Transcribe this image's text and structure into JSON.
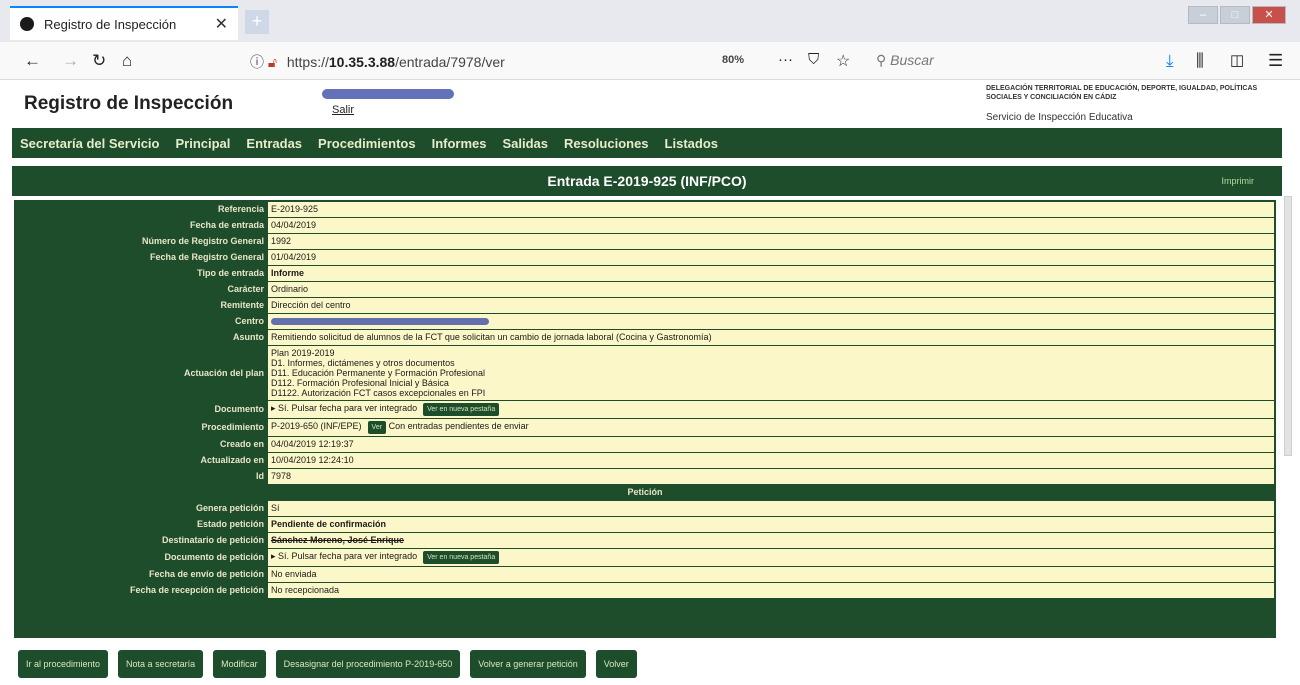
{
  "browser": {
    "tab_title": "Registro de Inspección",
    "url_prefix": "https://",
    "url_host": "10.35.3.88",
    "url_path": "/entrada/7978/ver",
    "zoom": "80%",
    "search_placeholder": "Buscar"
  },
  "site": {
    "title": "Registro de Inspección",
    "salir": "Salir",
    "delegacion": "DELEGACIÓN TERRITORIAL DE EDUCACIÓN, DEPORTE, IGUALDAD, POLÍTICAS SOCIALES Y CONCILIACIÓN EN CÁDIZ",
    "servicio": "Servicio de Inspección Educativa"
  },
  "nav": [
    "Secretaría del Servicio",
    "Principal",
    "Entradas",
    "Procedimientos",
    "Informes",
    "Salidas",
    "Resoluciones",
    "Listados"
  ],
  "header": {
    "title": "Entrada E-2019-925 (INF/PCO)",
    "imprimir": "Imprimir"
  },
  "fields": {
    "referencia": {
      "label": "Referencia",
      "value": "E-2019-925"
    },
    "fecha_entrada": {
      "label": "Fecha de entrada",
      "value": "04/04/2019"
    },
    "num_registro": {
      "label": "Número de Registro General",
      "value": "1992"
    },
    "fecha_registro": {
      "label": "Fecha de Registro General",
      "value": "01/04/2019"
    },
    "tipo_entrada": {
      "label": "Tipo de entrada",
      "value": "Informe"
    },
    "caracter": {
      "label": "Carácter",
      "value": "Ordinario"
    },
    "remitente": {
      "label": "Remitente",
      "value": "Dirección del centro"
    },
    "centro": {
      "label": "Centro"
    },
    "asunto": {
      "label": "Asunto",
      "value": "Remitiendo solicitud de alumnos de la FCT que solicitan un cambio de jornada laboral (Cocina y Gastronomía)"
    },
    "actuacion": {
      "label": "Actuación del plan",
      "lines": [
        "Plan 2019-2019",
        "D1. Informes, dictámenes y otros documentos",
        "D11. Educación Permanente y Formación Profesional",
        "D112. Formación Profesional Inicial y Básica",
        "D1122. Autorización FCT casos excepcionales en FPI"
      ]
    },
    "documento": {
      "label": "Documento",
      "value": "▸ Sí. Pulsar fecha para ver integrado",
      "btn": "Ver en nueva pestaña"
    },
    "procedimiento": {
      "label": "Procedimiento",
      "value": "P-2019-650 (INF/EPE)",
      "btn": "Ver",
      "note": "Con entradas pendientes de enviar"
    },
    "creado": {
      "label": "Creado en",
      "value": "04/04/2019 12:19:37"
    },
    "actualizado": {
      "label": "Actualizado en",
      "value": "10/04/2019 12:24:10"
    },
    "id": {
      "label": "Id",
      "value": "7978"
    }
  },
  "peticion": {
    "section_title": "Petición",
    "genera": {
      "label": "Genera petición",
      "value": "Sí"
    },
    "estado": {
      "label": "Estado petición",
      "value": "Pendiente de confirmación"
    },
    "destinatario": {
      "label": "Destinatario de petición",
      "value": "Sánchez Moreno, José Enrique"
    },
    "documento": {
      "label": "Documento de petición",
      "value": "▸ Sí. Pulsar fecha para ver integrado",
      "btn": "Ver en nueva pestaña"
    },
    "fecha_envio": {
      "label": "Fecha de envío de petición",
      "value": "No enviada"
    },
    "fecha_recepcion": {
      "label": "Fecha de recepción de petición",
      "value": "No recepcionada"
    }
  },
  "buttons": {
    "ir_proc": "Ir al procedimiento",
    "nota": "Nota a secretaría",
    "modificar": "Modificar",
    "desasignar": "Desasignar del procedimiento P-2019-650",
    "volver_generar": "Volver a generar petición",
    "volver": "Volver"
  }
}
